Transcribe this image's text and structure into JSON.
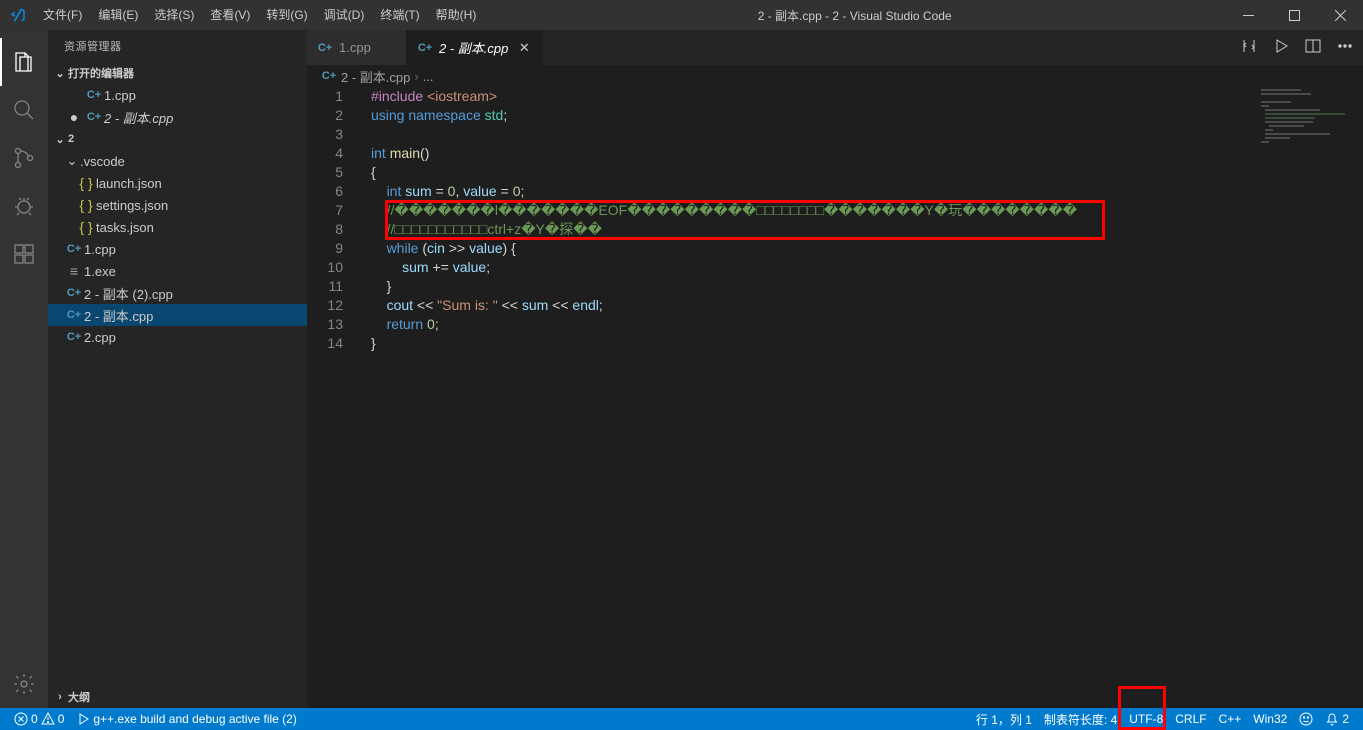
{
  "window": {
    "title": "2 - 副本.cpp - 2 - Visual Studio Code"
  },
  "menu": {
    "file": "文件(F)",
    "edit": "编辑(E)",
    "select": "选择(S)",
    "view": "查看(V)",
    "goto": "转到(G)",
    "debug": "调试(D)",
    "terminal": "终端(T)",
    "help": "帮助(H)"
  },
  "sidebar": {
    "title": "资源管理器",
    "sections": {
      "open_editors": "打开的编辑器",
      "workspace": "2",
      "outline": "大纲"
    },
    "open_editors": [
      {
        "label": "1.cpp",
        "modified": false
      },
      {
        "label": "2 - 副本.cpp",
        "modified": true
      }
    ],
    "tree": {
      "vscode_folder": ".vscode",
      "launch": "launch.json",
      "settings": "settings.json",
      "tasks": "tasks.json",
      "f1cpp": "1.cpp",
      "f1exe": "1.exe",
      "f2copy2": "2 - 副本 (2).cpp",
      "f2copy": "2 - 副本.cpp",
      "f2cpp": "2.cpp"
    }
  },
  "tabs": [
    {
      "label": "1.cpp",
      "active": false
    },
    {
      "label": "2 - 副本.cpp",
      "active": true
    }
  ],
  "breadcrumb": {
    "file": "2 - 副本.cpp",
    "sep": "›",
    "more": "..."
  },
  "code": {
    "lines": [
      "1",
      "2",
      "3",
      "4",
      "5",
      "6",
      "7",
      "8",
      "9",
      "10",
      "11",
      "12",
      "13",
      "14"
    ],
    "l1_macro": "#include",
    "l1_inc": "<iostream>",
    "l2_using": "using",
    "l2_ns": "namespace",
    "l2_std": "std",
    "l4_int": "int",
    "l4_main": "main",
    "l6_int": "int",
    "l6_sum": "sum",
    "l6_eq": "=",
    "l6_z1": "0",
    "l6_value": "value",
    "l6_z2": "0",
    "l7_comment": "//�������l�������EOF���������□□□□□□□□�������Y�玩��������",
    "l8_comment": "//□□□□□□□□□□□ctrl+z�Y�探��",
    "l9_while": "while",
    "l9_cin": "cin",
    "l9_op": ">>",
    "l9_value": "value",
    "l10_sum": "sum",
    "l10_op": "+=",
    "l10_value": "value",
    "l12_cout": "cout",
    "l12_op1": "<<",
    "l12_str": "\"Sum is: \"",
    "l12_sum": "sum",
    "l12_endl": "endl",
    "l13_return": "return",
    "l13_zero": "0"
  },
  "status": {
    "errors": "0",
    "warnings": "0",
    "build": "g++.exe build and debug active file (2)",
    "pos": "行 1，列 1",
    "tabsize": "制表符长度: 4",
    "encoding": "UTF-8",
    "eol": "CRLF",
    "lang": "C++",
    "os": "Win32",
    "notif": "2"
  }
}
